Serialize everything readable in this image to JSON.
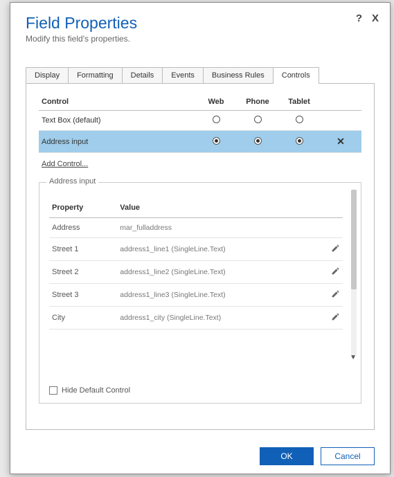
{
  "header": {
    "title": "Field Properties",
    "subtitle": "Modify this field's properties."
  },
  "help_tip": "?",
  "close_tip": "X",
  "tabs": [
    "Display",
    "Formatting",
    "Details",
    "Events",
    "Business Rules",
    "Controls"
  ],
  "grid": {
    "cols": {
      "control": "Control",
      "web": "Web",
      "phone": "Phone",
      "tablet": "Tablet"
    },
    "rows": [
      {
        "name": "Text Box (default)",
        "web": false,
        "phone": false,
        "tablet": false,
        "selected": false
      },
      {
        "name": "Address input",
        "web": true,
        "phone": true,
        "tablet": true,
        "selected": true
      }
    ]
  },
  "add_control": "Add Control...",
  "fieldset_title": "Address input",
  "prop_cols": {
    "prop": "Property",
    "val": "Value"
  },
  "props": [
    {
      "name": "Address",
      "value": "mar_fulladdress",
      "editable": false
    },
    {
      "name": "Street 1",
      "value": "address1_line1 (SingleLine.Text)",
      "editable": true
    },
    {
      "name": "Street 2",
      "value": "address1_line2 (SingleLine.Text)",
      "editable": true
    },
    {
      "name": "Street 3",
      "value": "address1_line3 (SingleLine.Text)",
      "editable": true
    },
    {
      "name": "City",
      "value": "address1_city (SingleLine.Text)",
      "editable": true
    }
  ],
  "hide_default": "Hide Default Control",
  "buttons": {
    "ok": "OK",
    "cancel": "Cancel"
  }
}
